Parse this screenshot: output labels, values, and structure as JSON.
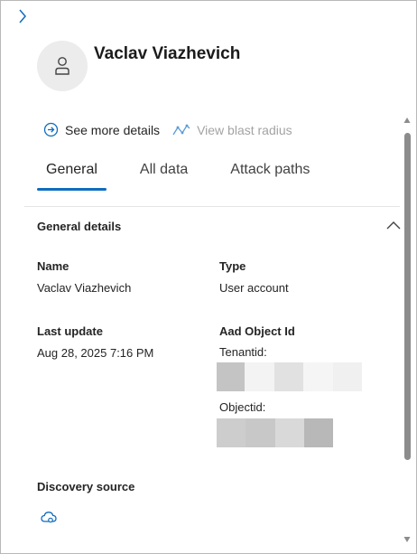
{
  "header": {
    "entity_name": "Vaclav Viazhevich",
    "avatar_icon": "person-icon",
    "collapse_icon": "chevron-right-icon"
  },
  "actions": [
    {
      "label": "See more details",
      "icon": "arrow-circle-right-icon",
      "enabled": true
    },
    {
      "label": "View blast radius",
      "icon": "graph-line-icon",
      "enabled": false
    }
  ],
  "tabs": [
    {
      "label": "General",
      "active": true
    },
    {
      "label": "All data",
      "active": false
    },
    {
      "label": "Attack paths",
      "active": false
    }
  ],
  "general_details": {
    "title": "General details",
    "expanded": true,
    "name_label": "Name",
    "name_value": "Vaclav Viazhevich",
    "type_label": "Type",
    "type_value": "User account",
    "last_update_label": "Last update",
    "last_update_value": "Aug 28, 2025 7:16 PM",
    "aad_label": "Aad Object Id",
    "tenantid_label": "Tenantid:",
    "objectid_label": "Objectid:",
    "discovery_label": "Discovery source",
    "discovery_icon": "cloud-icon"
  },
  "colors": {
    "accent": "#0f6cbd",
    "scroll_thumb": "#8c8c8c"
  }
}
